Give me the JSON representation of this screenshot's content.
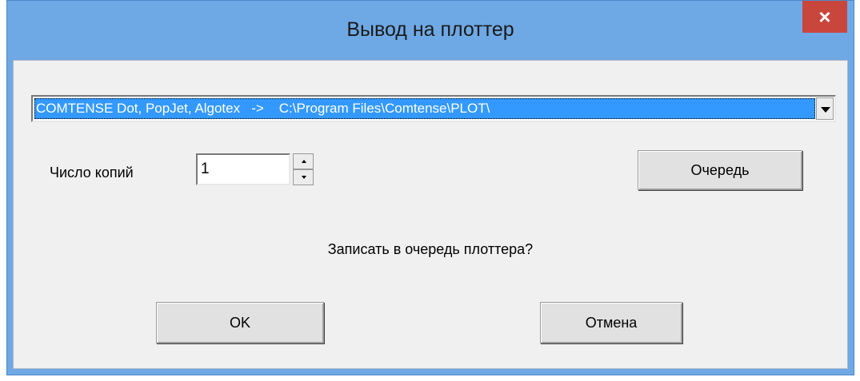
{
  "window": {
    "title": "Вывод на плоттер",
    "close_glyph": "×"
  },
  "plotter_select": {
    "selected_value": "COMTENSE Dot, PopJet, Algotex   ->    C:\\Program Files\\Comtense\\PLOT\\"
  },
  "copies": {
    "label": "Число копий",
    "value": "1"
  },
  "buttons": {
    "queue": "Очередь",
    "ok": "OK",
    "cancel": "Отмена"
  },
  "message": "Записать в очередь плоттера?",
  "colors": {
    "titlebar": "#6fa9e5",
    "close": "#c9463d",
    "selection": "#3399ff",
    "client": "#f0f0f0"
  }
}
